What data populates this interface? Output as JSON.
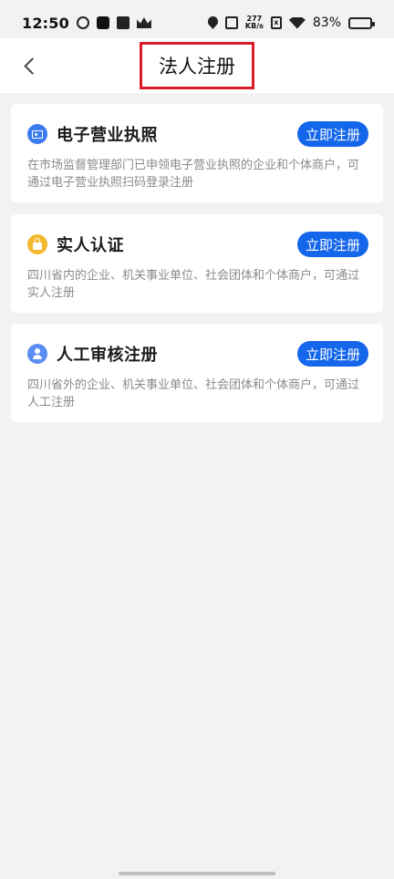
{
  "status_bar": {
    "time": "12:50",
    "net_speed_value": "277",
    "net_speed_unit": "KB/s",
    "battery_percent": "83%",
    "battery_level": 0.83
  },
  "header": {
    "back_icon": "chevron-left-icon",
    "title": "法人注册",
    "title_highlight_color": "#d91c2a"
  },
  "cards": [
    {
      "icon": "license-icon",
      "icon_color": "#3d7cf0",
      "title": "电子营业执照",
      "button_label": "立即注册",
      "description": "在市场监督管理部门已申领电子营业执照的企业和个体商户，可通过电子营业执照扫码登录注册"
    },
    {
      "icon": "lock-icon",
      "icon_color": "#f3b82b",
      "title": "实人认证",
      "button_label": "立即注册",
      "description": "四川省内的企业、机关事业单位、社会团体和个体商户，可通过实人注册"
    },
    {
      "icon": "person-icon",
      "icon_color": "#5b8ef3",
      "title": "人工审核注册",
      "button_label": "立即注册",
      "description": "四川省外的企业、机关事业单位、社会团体和个体商户，可通过人工注册"
    }
  ],
  "colors": {
    "accent": "#1466ea",
    "page_background": "#f2f2f4",
    "card_background": "#ffffff",
    "description_text": "#8a8a8a"
  }
}
